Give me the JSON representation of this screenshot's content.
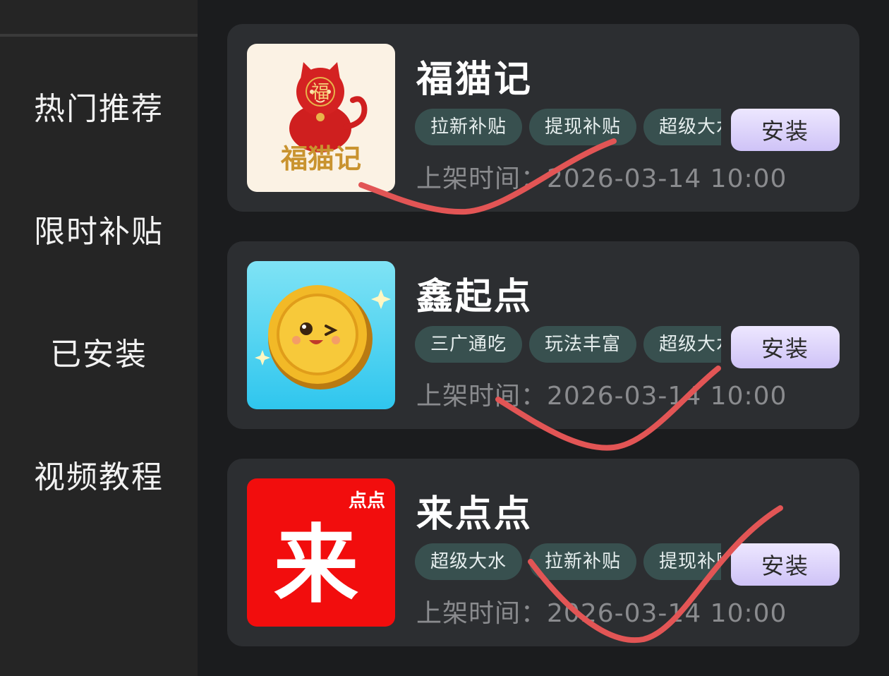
{
  "sidebar": {
    "items": [
      {
        "label": "热门推荐"
      },
      {
        "label": "限时补贴"
      },
      {
        "label": "已安装"
      },
      {
        "label": "视频教程"
      }
    ]
  },
  "apps": [
    {
      "name": "福猫记",
      "icon": "lucky-cat-icon",
      "icon_text": "福猫记",
      "icon_badge": "福",
      "tags": [
        "拉新补贴",
        "提现补贴",
        "超级大水"
      ],
      "install_label": "安装",
      "release_label": "上架时间：",
      "release_time": "2026-03-14 10:00"
    },
    {
      "name": "鑫起点",
      "icon": "gold-coin-icon",
      "tags": [
        "三广通吃",
        "玩法丰富",
        "超级大水"
      ],
      "install_label": "安装",
      "release_label": "上架时间：",
      "release_time": "2026-03-14 10:00"
    },
    {
      "name": "来点点",
      "icon": "lai-character-icon",
      "icon_text": "来",
      "icon_badge": "点点",
      "tags": [
        "超级大水",
        "拉新补贴",
        "提现补贴"
      ],
      "install_label": "安装",
      "release_label": "上架时间：",
      "release_time": "2026-03-14 10:00"
    }
  ],
  "colors": {
    "background": "#1b1c1e",
    "sidebar": "#252525",
    "card": "#2c2e31",
    "tag_bg": "#38504f",
    "install_bg": "#dcd3fb",
    "annotation": "#e25555"
  }
}
